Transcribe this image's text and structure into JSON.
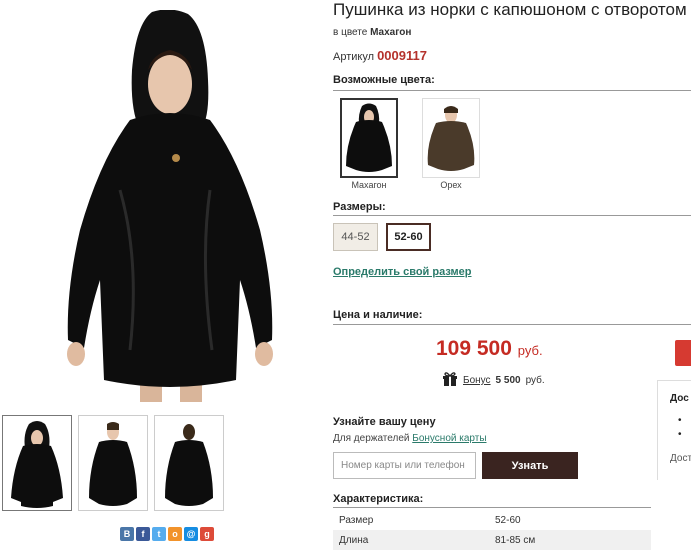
{
  "product": {
    "title": "Пушинка из норки с капюшоном с отворотом",
    "color_prefix": "в цвете",
    "color_name": "Махагон",
    "article_prefix": "Артикул",
    "article_value": "0009117"
  },
  "colors": {
    "label": "Возможные цвета:",
    "items": [
      {
        "name": "Махагон",
        "selected": true,
        "tone": "#111111"
      },
      {
        "name": "Орех",
        "selected": false,
        "tone": "#4a3a2a"
      }
    ]
  },
  "sizes": {
    "label": "Размеры:",
    "items": [
      {
        "label": "44-52",
        "selected": false
      },
      {
        "label": "52-60",
        "selected": true
      }
    ],
    "define_link": "Определить свой размер"
  },
  "price_section": {
    "label": "Цена и наличие:",
    "price": "109 500",
    "currency": "руб.",
    "bonus_link": "Бонус",
    "bonus_value": "5 500",
    "bonus_currency": "руб."
  },
  "side_box": {
    "heading": "Дос",
    "bullet1": "•",
    "bullet2": "•",
    "footer": "Дост"
  },
  "price_check": {
    "heading": "Узнайте вашу цену",
    "holders_text": "Для держателей",
    "card_link": "Бонусной карты",
    "input_placeholder": "Номер карты или телефон",
    "button_label": "Узнать"
  },
  "specs": {
    "label": "Характеристика:",
    "rows": [
      {
        "name": "Размер",
        "value": "52-60"
      },
      {
        "name": "Длина",
        "value": "81-85 см"
      }
    ]
  },
  "share": {
    "icons": [
      {
        "name": "vk-icon",
        "glyph": "В",
        "color": "#4a76a8"
      },
      {
        "name": "facebook-icon",
        "glyph": "f",
        "color": "#3b5998"
      },
      {
        "name": "twitter-icon",
        "glyph": "t",
        "color": "#55acee"
      },
      {
        "name": "odnoklassniki-icon",
        "glyph": "о",
        "color": "#f2932b"
      },
      {
        "name": "mailru-icon",
        "glyph": "@",
        "color": "#168de2"
      },
      {
        "name": "googleplus-icon",
        "glyph": "g",
        "color": "#dd4b39"
      }
    ]
  }
}
